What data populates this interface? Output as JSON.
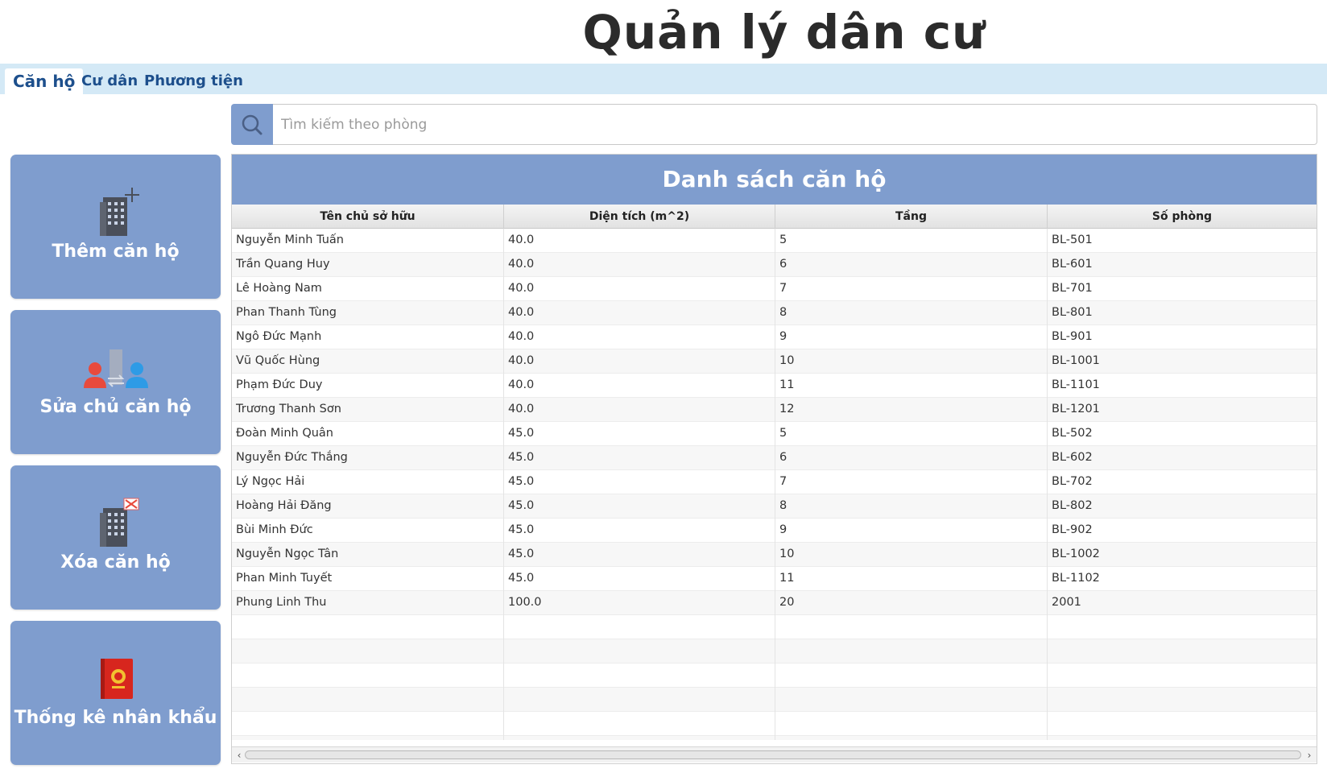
{
  "app": {
    "title": "Quản lý dân cư"
  },
  "tabs": [
    {
      "label": "Căn hộ",
      "active": true
    },
    {
      "label": "Cư dân",
      "active": false
    },
    {
      "label": "Phương tiện",
      "active": false
    }
  ],
  "search": {
    "placeholder": "Tìm kiếm theo phòng",
    "value": "",
    "icon": "search-icon"
  },
  "sidebar": {
    "buttons": [
      {
        "label": "Thêm căn hộ",
        "icon": "building-add-icon"
      },
      {
        "label": "Sửa chủ căn hộ",
        "icon": "owner-swap-icon"
      },
      {
        "label": "Xóa căn hộ",
        "icon": "building-delete-icon"
      },
      {
        "label": "Thống kê nhân khẩu",
        "icon": "household-book-icon"
      }
    ]
  },
  "panel": {
    "title": "Danh sách căn hộ"
  },
  "table": {
    "columns": [
      "Tên chủ sở hữu",
      "Diện tích (m^2)",
      "Tầng",
      "Số phòng"
    ],
    "rows": [
      [
        "Nguyễn Minh Tuấn",
        "40.0",
        "5",
        "BL-501"
      ],
      [
        "Trần Quang Huy",
        "40.0",
        "6",
        "BL-601"
      ],
      [
        "Lê Hoàng Nam",
        "40.0",
        "7",
        "BL-701"
      ],
      [
        "Phan Thanh Tùng",
        "40.0",
        "8",
        "BL-801"
      ],
      [
        "Ngô Đức Mạnh",
        "40.0",
        "9",
        "BL-901"
      ],
      [
        "Vũ Quốc Hùng",
        "40.0",
        "10",
        "BL-1001"
      ],
      [
        "Phạm Đức Duy",
        "40.0",
        "11",
        "BL-1101"
      ],
      [
        "Trương Thanh Sơn",
        "40.0",
        "12",
        "BL-1201"
      ],
      [
        "Đoàn Minh Quân",
        "45.0",
        "5",
        "BL-502"
      ],
      [
        "Nguyễn Đức Thắng",
        "45.0",
        "6",
        "BL-602"
      ],
      [
        "Lý Ngọc Hải",
        "45.0",
        "7",
        "BL-702"
      ],
      [
        "Hoàng Hải Đăng",
        "45.0",
        "8",
        "BL-802"
      ],
      [
        "Bùi Minh Đức",
        "45.0",
        "9",
        "BL-902"
      ],
      [
        "Nguyễn Ngọc Tân",
        "45.0",
        "10",
        "BL-1002"
      ],
      [
        "Phan Minh Tuyết",
        "45.0",
        "11",
        "BL-1102"
      ],
      [
        "Phung Linh Thu",
        "100.0",
        "20",
        "2001"
      ]
    ]
  },
  "colors": {
    "accent": "#7f9dce",
    "tabbar": "#d4e9f6",
    "tab_text": "#1d4f8c"
  }
}
